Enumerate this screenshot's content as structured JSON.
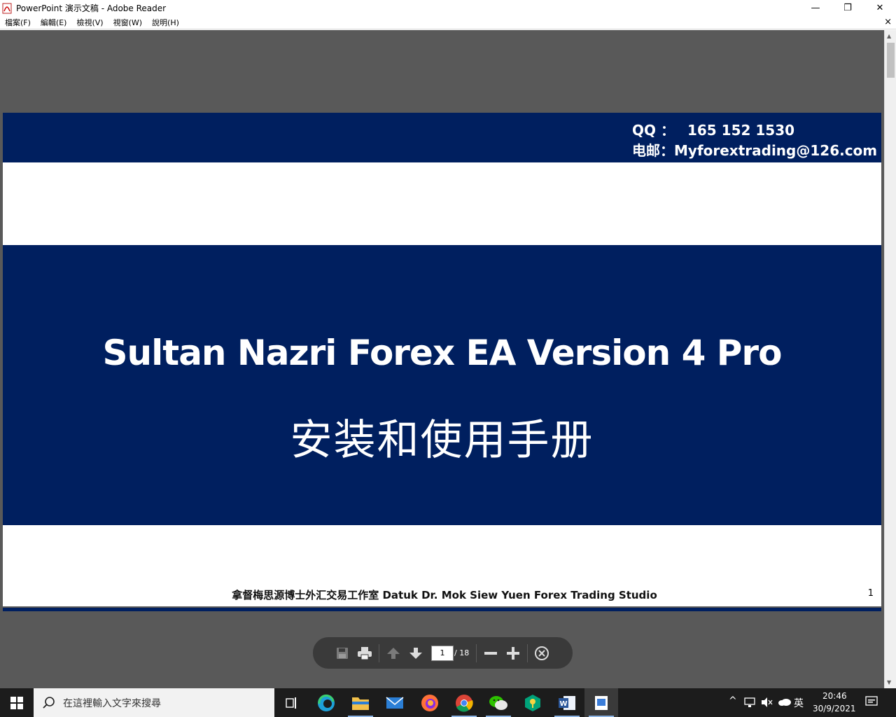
{
  "window": {
    "title": "PowerPoint 演示文稿 - Adobe Reader",
    "minimize": "—",
    "restore": "❐",
    "close": "✕"
  },
  "menu": {
    "items": [
      "檔案(F)",
      "編輯(E)",
      "檢視(V)",
      "視窗(W)",
      "說明(H)"
    ],
    "close": "×"
  },
  "slide": {
    "qq_label": "QQ ：",
    "qq_value": "165 152 1530",
    "mail_label": "电邮：",
    "mail_value": "Myforextrading@126.com",
    "title_en": "Sultan Nazri Forex EA Version 4 Pro",
    "title_zh": "安装和使用手册",
    "footer": "拿督梅思源博士外汇交易工作室 Datuk Dr. Mok Siew Yuen Forex Trading Studio",
    "page_number": "1"
  },
  "toolbar": {
    "current_page": "1",
    "total_pages": "/ 18"
  },
  "taskbar": {
    "search_placeholder": "在這裡輸入文字來搜尋",
    "ime": "英",
    "time": "20:46",
    "date": "30/9/2021"
  },
  "colors": {
    "navy": "#001f5f",
    "doc_bg": "#595959"
  }
}
